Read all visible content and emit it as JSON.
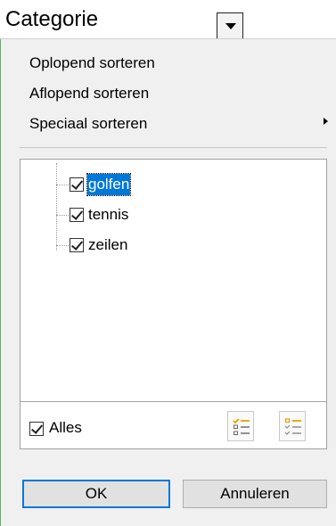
{
  "header": {
    "title": "Categorie"
  },
  "menu": {
    "items": [
      {
        "label": "Oplopend sorteren"
      },
      {
        "label": "Aflopend sorteren"
      },
      {
        "label": "Speciaal sorteren"
      }
    ]
  },
  "list": {
    "items": [
      {
        "label": "golfen",
        "checked": true,
        "selected": true
      },
      {
        "label": "tennis",
        "checked": true,
        "selected": false
      },
      {
        "label": "zeilen",
        "checked": true,
        "selected": false
      }
    ]
  },
  "footer": {
    "all_label": "Alles",
    "all_checked": true,
    "select_all_icon": "check-list-icon",
    "unselect_icon": "uncheck-list-icon"
  },
  "buttons": {
    "ok": "OK",
    "cancel": "Annuleren"
  },
  "colors": {
    "selection": "#0078d7",
    "accent_icon": "#e8a000",
    "border_green": "#5ab55a"
  }
}
